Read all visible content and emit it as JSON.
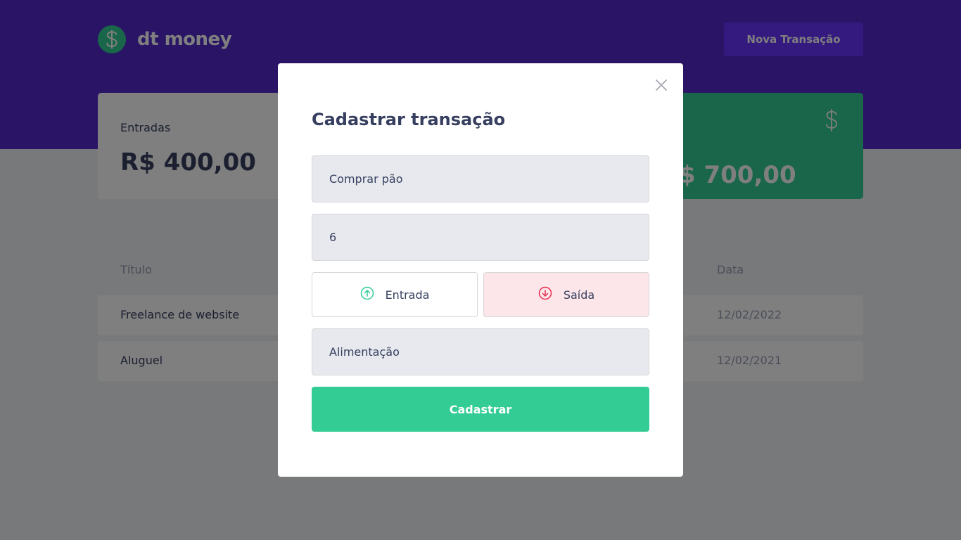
{
  "app": {
    "name": "dt money"
  },
  "header": {
    "new_transaction_label": "Nova Transação"
  },
  "summary": {
    "income_label": "Entradas",
    "income_value": "R$ 400,00",
    "total_value_visible": "$ 700,00"
  },
  "table": {
    "headers": {
      "title": "Título",
      "date": "Data"
    },
    "rows": [
      {
        "title": "Freelance de website",
        "date": "12/02/2022"
      },
      {
        "title": "Aluguel",
        "date": "12/02/2021"
      }
    ]
  },
  "modal": {
    "title": "Cadastrar transação",
    "fields": {
      "title_value": "Comprar pão",
      "amount_value": "6",
      "category_value": "Alimentação"
    },
    "type_options": {
      "deposit_label": "Entrada",
      "withdraw_label": "Saída",
      "selected": "withdraw"
    },
    "submit_label": "Cadastrar"
  },
  "colors": {
    "primary": "#5429cc",
    "primary_light": "#6933ff",
    "green": "#33cc95",
    "red": "#e52e4d",
    "text_title": "#363f5f",
    "text_body": "#969cb3",
    "background": "#f0f2f5"
  },
  "icons": {
    "logo": "dollar-circle-icon",
    "total_card": "dollar-icon",
    "close": "close-icon",
    "deposit": "arrow-up-circle-icon",
    "withdraw": "arrow-down-circle-icon"
  }
}
